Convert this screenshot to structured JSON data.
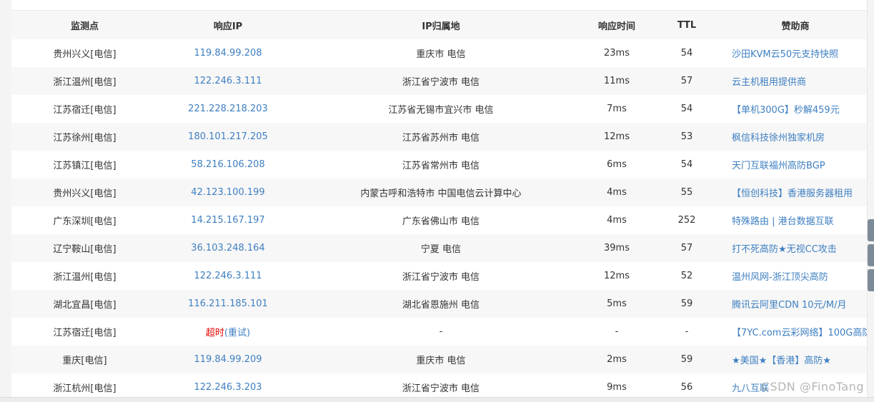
{
  "headers": [
    "监测点",
    "响应IP",
    "IP归属地",
    "响应时间",
    "TTL",
    "赞助商"
  ],
  "rows": [
    {
      "site": "贵州兴义[电信]",
      "ip": "119.84.99.208",
      "loc": "重庆市 电信",
      "time": "23ms",
      "ttl": "54",
      "sponsor": "沙田KVM云50元支持快照"
    },
    {
      "site": "浙江温州[电信]",
      "ip": "122.246.3.111",
      "loc": "浙江省宁波市 电信",
      "time": "11ms",
      "ttl": "57",
      "sponsor": "云主机租用提供商"
    },
    {
      "site": "江苏宿迁[电信]",
      "ip": "221.228.218.203",
      "loc": "江苏省无锡市宜兴市 电信",
      "time": "7ms",
      "ttl": "54",
      "sponsor": "【单机300G】秒解459元"
    },
    {
      "site": "江苏徐州[电信]",
      "ip": "180.101.217.205",
      "loc": "江苏省苏州市 电信",
      "time": "12ms",
      "ttl": "53",
      "sponsor": "枫信科技徐州独家机房"
    },
    {
      "site": "江苏镇江[电信]",
      "ip": "58.216.106.208",
      "loc": "江苏省常州市 电信",
      "time": "6ms",
      "ttl": "54",
      "sponsor": "天门互联福州高防BGP"
    },
    {
      "site": "贵州兴义[电信]",
      "ip": "42.123.100.199",
      "loc": "内蒙古呼和浩特市 中国电信云计算中心",
      "time": "4ms",
      "ttl": "55",
      "sponsor": "【恒创科技】香港服务器租用"
    },
    {
      "site": "广东深圳[电信]",
      "ip": "14.215.167.197",
      "loc": "广东省佛山市 电信",
      "time": "4ms",
      "ttl": "252",
      "sponsor": "特殊路由 | 港台数据互联"
    },
    {
      "site": "辽宁鞍山[电信]",
      "ip": "36.103.248.164",
      "loc": "宁夏 电信",
      "time": "39ms",
      "ttl": "57",
      "sponsor": "打不死高防★无视CC攻击"
    },
    {
      "site": "浙江温州[电信]",
      "ip": "122.246.3.111",
      "loc": "浙江省宁波市 电信",
      "time": "12ms",
      "ttl": "52",
      "sponsor": "温州风网-浙江顶尖高防"
    },
    {
      "site": "湖北宜昌[电信]",
      "ip": "116.211.185.101",
      "loc": "湖北省恩施州 电信",
      "time": "5ms",
      "ttl": "59",
      "sponsor": "腾讯云阿里CDN 10元/M/月"
    },
    {
      "site": "江苏宿迁[电信]",
      "ip": "",
      "ip_timeout": "超时",
      "ip_retry": "(重试)",
      "loc": "-",
      "time": "-",
      "ttl": "-",
      "sponsor": "【7YC.com云彩网络】100G高防"
    },
    {
      "site": "重庆[电信]",
      "ip": "119.84.99.209",
      "loc": "重庆市 电信",
      "time": "2ms",
      "ttl": "59",
      "sponsor": "★美国★【香港】高防★"
    },
    {
      "site": "浙江杭州[电信]",
      "ip": "122.246.3.203",
      "loc": "浙江省宁波市 电信",
      "time": "9ms",
      "ttl": "56",
      "sponsor": "九八互联"
    }
  ],
  "watermark": "CSDN @FinoTang",
  "colors": {
    "link": "#3e7fc1",
    "timeout": "#e60000",
    "stripe": "#f7f7f7"
  }
}
